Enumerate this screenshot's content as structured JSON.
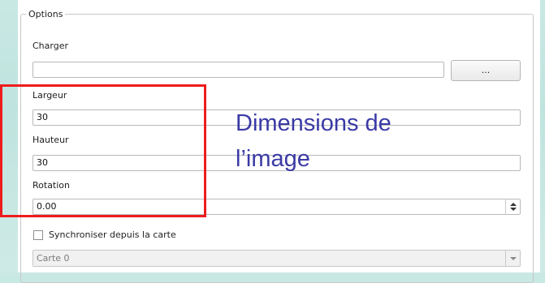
{
  "options_group": {
    "title": "Options",
    "load_label": "Charger",
    "load_value": "",
    "browse_button_label": "...",
    "width_label": "Largeur",
    "width_value": "30",
    "height_label": "Hauteur",
    "height_value": "30",
    "rotation_label": "Rotation",
    "rotation_value": "0.00",
    "sync_label": "Synchroniser depuis la carte",
    "sync_checked": false,
    "map_select_value": "Carte 0"
  },
  "annotation": {
    "line1": "Dimensions de",
    "line2": "l’image",
    "text_color": "#3a3aa6",
    "highlight_color": "#ee1c1c"
  }
}
